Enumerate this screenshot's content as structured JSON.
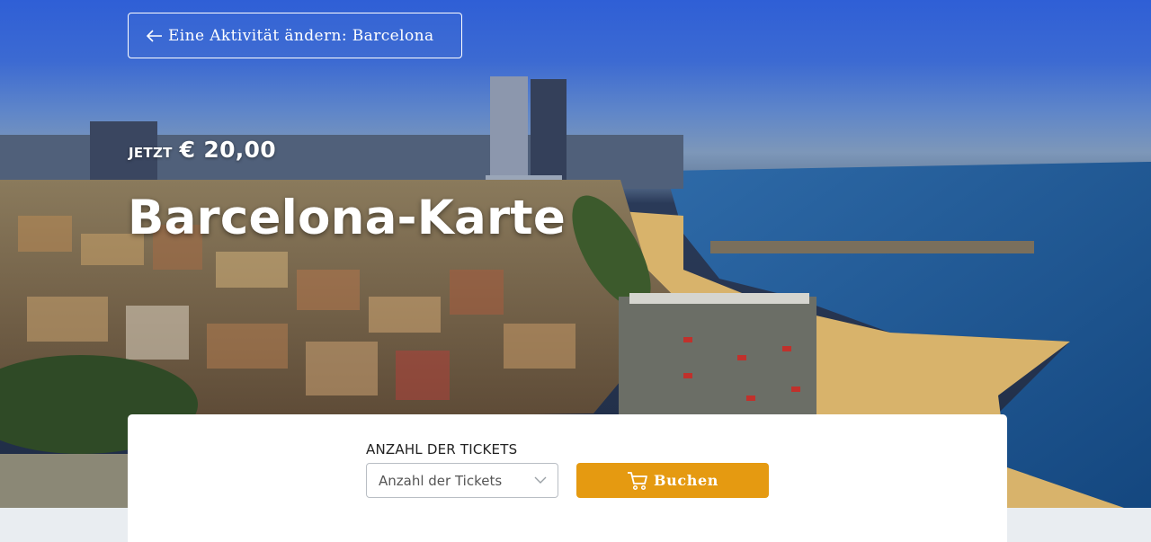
{
  "back_link": {
    "label": "Eine Aktivität ändern: Barcelona",
    "icon": "arrow-left-icon"
  },
  "price": {
    "prefix": "JETZT",
    "amount": "€ 20,00"
  },
  "title": "Barcelona-Karte",
  "booking": {
    "tickets_label": "ANZAHL DER TICKETS",
    "tickets_select": {
      "selected": "Anzahl der Tickets",
      "icon": "chevron-down-icon"
    },
    "book_button": {
      "label": "Buchen",
      "icon": "cart-icon"
    }
  },
  "colors": {
    "accent": "#e59a11",
    "card_bg": "#ffffff",
    "page_bg": "#e9edf1"
  }
}
